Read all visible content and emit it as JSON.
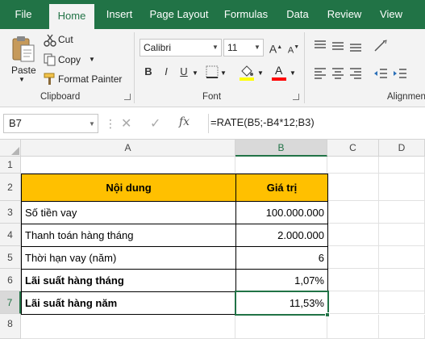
{
  "tabs": [
    "File",
    "Home",
    "Insert",
    "Page Layout",
    "Formulas",
    "Data",
    "Review",
    "View"
  ],
  "active_tab": "Home",
  "clipboard": {
    "paste_label": "Paste",
    "cut_label": "Cut",
    "copy_label": "Copy",
    "format_painter_label": "Format Painter",
    "group_label": "Clipboard"
  },
  "font": {
    "family": "Calibri",
    "size": "11",
    "group_label": "Font",
    "bold_label": "B",
    "italic_label": "I",
    "underline_label": "U",
    "grow_label": "A",
    "shrink_label": "A",
    "font_color_label": "A"
  },
  "alignment": {
    "group_label": "Alignment"
  },
  "colors": {
    "accent": "#217346",
    "header_fill": "#ffc000",
    "fill_color_bar": "#ffff00",
    "font_color_bar": "#ff0000"
  },
  "formula_bar": {
    "name_box": "B7",
    "fx_label": "fx",
    "formula": "=RATE(B5;-B4*12;B3)"
  },
  "sheet": {
    "columns": [
      "A",
      "B",
      "C",
      "D"
    ],
    "rows": [
      "1",
      "2",
      "3",
      "4",
      "5",
      "6",
      "7",
      "8"
    ],
    "selected_cell": "B7",
    "header": {
      "a": "Nội dung",
      "b": "Giá trị"
    },
    "data_rows": [
      {
        "label": "Số tiền vay",
        "value": "100.000.000",
        "bold": false
      },
      {
        "label": "Thanh toán hàng tháng",
        "value": "2.000.000",
        "bold": false
      },
      {
        "label": "Thời hạn vay (năm)",
        "value": "6",
        "bold": false
      },
      {
        "label": "Lãi suất hàng tháng",
        "value": "1,07%",
        "bold": true
      },
      {
        "label": "Lãi suất hàng năm",
        "value": "11,53%",
        "bold": true
      }
    ]
  }
}
